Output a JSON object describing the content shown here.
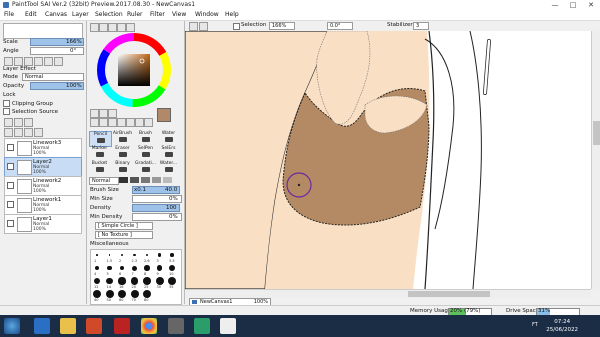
{
  "titlebar": {
    "title": "PaintTool SAI Ver.2 (32bit) Preview.2017.08.30 - NewCanvas1",
    "min": "—",
    "max": "□",
    "close": "✕"
  },
  "menu": [
    "File",
    "Edit",
    "Canvas",
    "Layer",
    "Selection",
    "Ruler",
    "Filter",
    "View",
    "Window",
    "Help"
  ],
  "canvas_toolbar": {
    "selection_label": "Selection",
    "zoom": "166%",
    "angle": "0.0°",
    "stabilizer_label": "Stabilizer",
    "stabilizer_value": "3"
  },
  "layer_panel": {
    "scale_label": "Scale",
    "scale_value": "166%",
    "angle_label": "Angle",
    "angle_value": "0°",
    "layer_effect": "Layer Effect",
    "mode_label": "Mode",
    "mode_value": "Normal",
    "opacity_label": "Opacity",
    "opacity_value": "100%",
    "lock_label": "Lock",
    "clipping_group": "Clipping Group",
    "selection_source": "Selection Source",
    "layers": [
      {
        "name": "Linework3",
        "mode": "Normal",
        "opacity": "100%"
      },
      {
        "name": "Layer2",
        "mode": "Normal",
        "opacity": "100%"
      },
      {
        "name": "Linework2",
        "mode": "Normal",
        "opacity": "100%"
      },
      {
        "name": "Linework1",
        "mode": "Normal",
        "opacity": "100%"
      },
      {
        "name": "Layer1",
        "mode": "Normal",
        "opacity": "100%"
      }
    ]
  },
  "tool_panel": {
    "current_color": "#b08a68",
    "tools": [
      {
        "label": "Pencil"
      },
      {
        "label": "AirBrush"
      },
      {
        "label": "Brush"
      },
      {
        "label": "Water"
      },
      {
        "label": "Marker"
      },
      {
        "label": "Eraser"
      },
      {
        "label": "SelPen"
      },
      {
        "label": "SelErs"
      },
      {
        "label": "Bucket"
      },
      {
        "label": "Binary"
      },
      {
        "label": "Gradati..."
      },
      {
        "label": "Water..."
      }
    ],
    "blend_mode": "Normal",
    "brush_size_label": "Brush Size",
    "brush_size_mult": "x0.1",
    "brush_size_value": "40.0",
    "min_size_label": "Min Size",
    "min_size_value": "0%",
    "density_label": "Density",
    "density_value": "100",
    "min_density_label": "Min Density",
    "min_density_value": "0%",
    "edge_label": "[ Simple Circle ]",
    "texture_label": "[ No Texture ]",
    "misc_label": "Miscellaneous",
    "brush_sizes": [
      "1",
      "1.5",
      "2",
      "2.3",
      "2.6",
      "3",
      "3.5",
      "4",
      "5",
      "6",
      "7",
      "8",
      "9",
      "10",
      "12",
      "14",
      "16",
      "20",
      "25",
      "30",
      "35",
      "40",
      "50",
      "60",
      "70",
      "80"
    ]
  },
  "navigator": {
    "canvas_name": "NewCanvas1",
    "zoom": "100%"
  },
  "status": {
    "memory_label": "Memory Usage",
    "memory_value": "20% (79%)",
    "drive_label": "Drive Space",
    "drive_value": "31%"
  },
  "taskbar": {
    "time": "07:24",
    "date": "25/06/2022",
    "lang": "FT"
  },
  "colors": {
    "skin_light": "#f9dfc3",
    "skin_shadow": "#b48a64",
    "selection": "#c8ddf5",
    "accent": "#3c6fb4"
  }
}
